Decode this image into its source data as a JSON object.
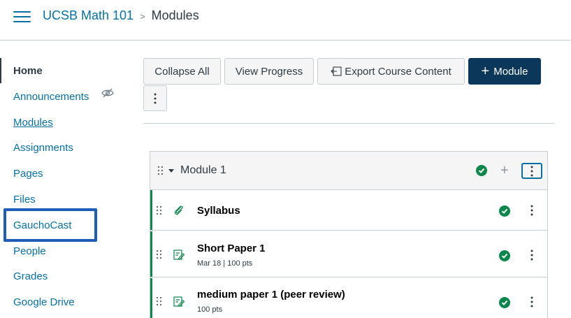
{
  "header": {
    "course_name": "UCSB Math 101",
    "separator": ">",
    "current_page": "Modules"
  },
  "sidebar": {
    "items": [
      {
        "label": "Home",
        "active": true
      },
      {
        "label": "Announcements",
        "hidden_indicator": "eye-slash-icon"
      },
      {
        "label": "Modules"
      },
      {
        "label": "Assignments"
      },
      {
        "label": "Pages"
      },
      {
        "label": "Files"
      },
      {
        "label": "GauchoCast",
        "highlighted": true
      },
      {
        "label": "People"
      },
      {
        "label": "Grades"
      },
      {
        "label": "Google Drive"
      }
    ]
  },
  "toolbar": {
    "collapse_all": "Collapse All",
    "view_progress": "View Progress",
    "export_content": "Export Course Content",
    "add_module": "Module",
    "add_module_icon": "plus-icon",
    "more_icon": "kebab-icon"
  },
  "module": {
    "title": "Module 1",
    "status_icon": "check-circle-icon",
    "items": [
      {
        "title": "Syllabus",
        "icon": "attachment-icon",
        "meta": ""
      },
      {
        "title": "Short Paper 1",
        "icon": "assignment-icon",
        "meta": "Mar 18  |  100 pts"
      },
      {
        "title": "medium paper 1 (peer review)",
        "icon": "assignment-icon",
        "meta": "100 pts"
      }
    ]
  },
  "colors": {
    "link": "#0770a3",
    "primary_button": "#0b375b",
    "complete_green": "#0b874b",
    "highlight_box": "#1f5db8"
  }
}
